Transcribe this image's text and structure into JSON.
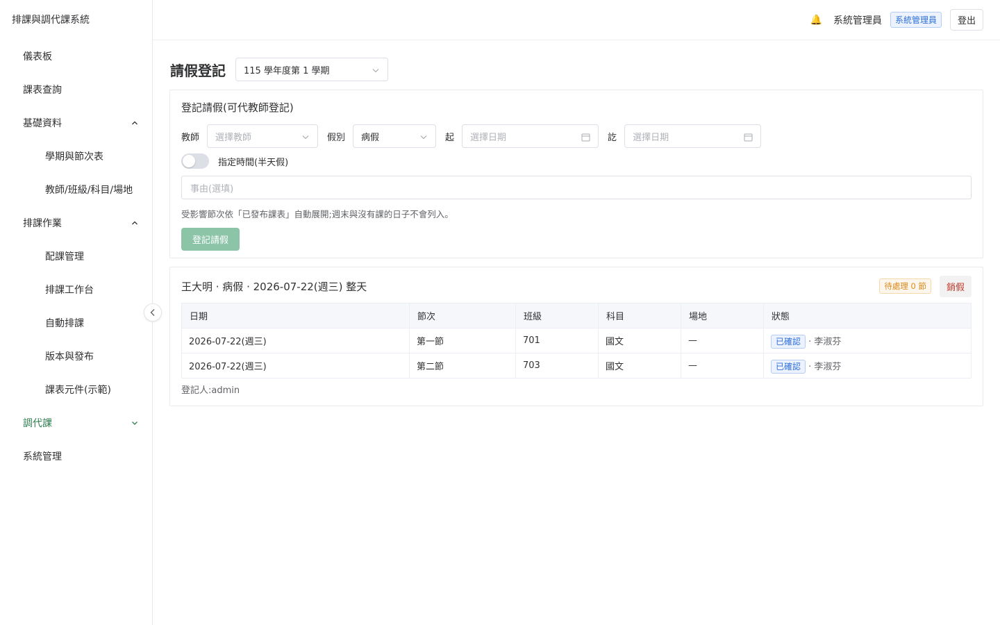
{
  "app": {
    "title": "排課與調代課系統"
  },
  "sidebar": {
    "items": [
      {
        "label": "儀表板",
        "level": 1
      },
      {
        "label": "課表查詢",
        "level": 1
      },
      {
        "label": "基礎資料",
        "level": 1,
        "expanded": true
      },
      {
        "label": "學期與節次表",
        "level": 2
      },
      {
        "label": "教師/班級/科目/場地",
        "level": 2
      },
      {
        "label": "排課作業",
        "level": 1,
        "expanded": true
      },
      {
        "label": "配課管理",
        "level": 2
      },
      {
        "label": "排課工作台",
        "level": 2
      },
      {
        "label": "自動排課",
        "level": 2
      },
      {
        "label": "版本與發布",
        "level": 2
      },
      {
        "label": "課表元件(示範)",
        "level": 2
      },
      {
        "label": "調代課",
        "level": 1,
        "expanded": false,
        "active": true
      },
      {
        "label": "系統管理",
        "level": 1
      }
    ]
  },
  "header": {
    "bell_icon": "🔔",
    "user_name": "系統管理員",
    "role_badge": "系統管理員",
    "logout_label": "登出"
  },
  "page": {
    "title": "請假登記",
    "term_select": "115 學年度第 1 學期"
  },
  "form": {
    "title": "登記請假(可代教師登記)",
    "teacher_label": "教師",
    "teacher_placeholder": "選擇教師",
    "type_label": "假別",
    "type_value": "病假",
    "from_label": "起",
    "from_placeholder": "選擇日期",
    "to_label": "訖",
    "to_placeholder": "選擇日期",
    "half_day_label": "指定時間(半天假)",
    "half_day_on": false,
    "reason_placeholder": "事由(選填)",
    "hint": "受影響節次依「已發布課表」自動展開;週末與沒有課的日子不會列入。",
    "submit_label": "登記請假"
  },
  "record": {
    "title": "王大明 · 病假 · 2026-07-22(週三) 整天",
    "pending_badge": "待處理 0 節",
    "cancel_label": "銷假",
    "columns": [
      "日期",
      "節次",
      "班級",
      "科目",
      "場地",
      "狀態"
    ],
    "rows": [
      {
        "date": "2026-07-22(週三)",
        "period": "第一節",
        "class": "701",
        "subject": "國文",
        "room": "—",
        "status": "已確認",
        "by": "· 李淑芬"
      },
      {
        "date": "2026-07-22(週三)",
        "period": "第二節",
        "class": "703",
        "subject": "國文",
        "room": "—",
        "status": "已確認",
        "by": "· 李淑芬"
      }
    ],
    "recorder": "登記人:admin"
  },
  "colors": {
    "accent": "#2e7d4f",
    "primary_button_disabled": "#8cc4a8",
    "tag_blue": "#2f6fd6",
    "tag_orange": "#d98b1d",
    "danger": "#c0392b"
  }
}
